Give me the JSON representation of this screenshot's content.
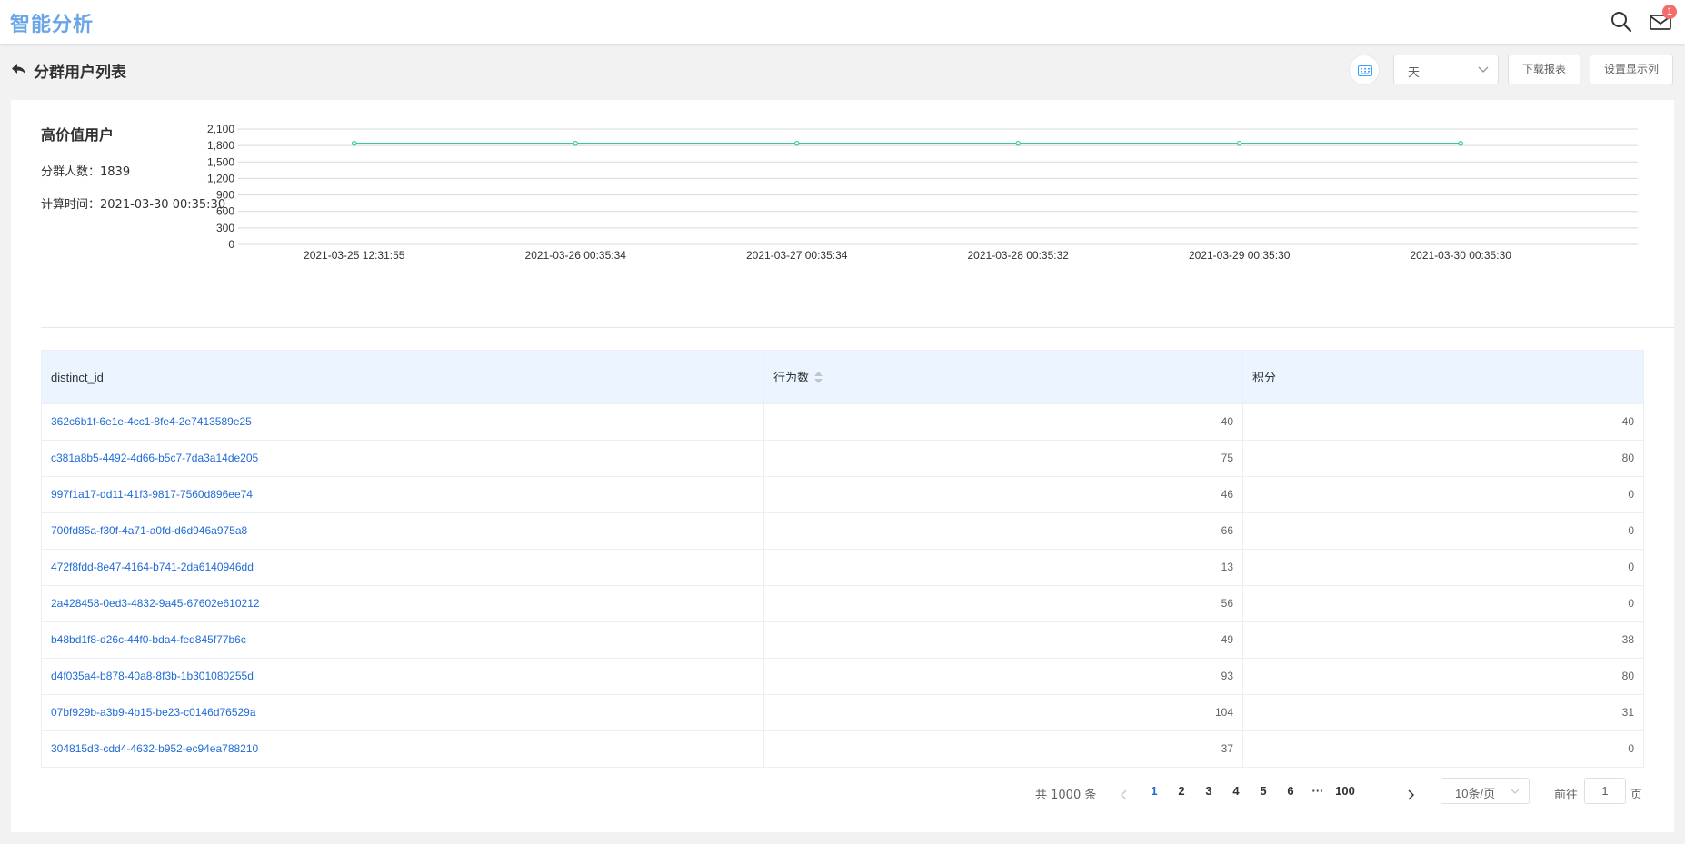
{
  "app": {
    "brand": "智能分析",
    "mail_badge": "1"
  },
  "header": {
    "title": "分群用户列表",
    "granularity": "天",
    "download_label": "下载报表",
    "columns_label": "设置显示列"
  },
  "group": {
    "name": "高价值用户",
    "count_label": "分群人数：",
    "count": "1839",
    "time_label": "计算时间：",
    "time": "2021-03-30 00:35:30"
  },
  "chart_data": {
    "type": "line",
    "x": [
      "2021-03-25 12:31:55",
      "2021-03-26 00:35:34",
      "2021-03-27 00:35:34",
      "2021-03-28 00:35:32",
      "2021-03-29 00:35:30",
      "2021-03-30 00:35:30"
    ],
    "series": [
      {
        "values": [
          1839,
          1839,
          1839,
          1839,
          1839,
          1839
        ],
        "color": "#35c9a4"
      }
    ],
    "y_ticks": [
      "0",
      "300",
      "600",
      "900",
      "1,200",
      "1,500",
      "1,800",
      "2,100"
    ],
    "ylim": [
      0,
      2100
    ],
    "grid": true
  },
  "table": {
    "columns": [
      "distinct_id",
      "行为数",
      "积分"
    ],
    "rows": [
      [
        "362c6b1f-6e1e-4cc1-8fe4-2e7413589e25",
        "40",
        "40"
      ],
      [
        "c381a8b5-4492-4d66-b5c7-7da3a14de205",
        "75",
        "80"
      ],
      [
        "997f1a17-dd11-41f3-9817-7560d896ee74",
        "46",
        "0"
      ],
      [
        "700fd85a-f30f-4a71-a0fd-d6d946a975a8",
        "66",
        "0"
      ],
      [
        "472f8fdd-8e47-4164-b741-2da6140946dd",
        "13",
        "0"
      ],
      [
        "2a428458-0ed3-4832-9a45-67602e610212",
        "56",
        "0"
      ],
      [
        "b48bd1f8-d26c-44f0-bda4-fed845f77b6c",
        "49",
        "38"
      ],
      [
        "d4f035a4-b878-40a8-8f3b-1b301080255d",
        "93",
        "80"
      ],
      [
        "07bf929b-a3b9-4b15-be23-c0146d76529a",
        "104",
        "31"
      ],
      [
        "304815d3-cdd4-4632-b952-ec94ea788210",
        "37",
        "0"
      ]
    ]
  },
  "pagination": {
    "total_label": "共 1000 条",
    "pages": [
      "1",
      "2",
      "3",
      "4",
      "5",
      "6",
      "···",
      "100"
    ],
    "current": "1",
    "page_size": "10条/页",
    "goto_prefix": "前往",
    "goto_value": "1",
    "goto_suffix": "页"
  }
}
